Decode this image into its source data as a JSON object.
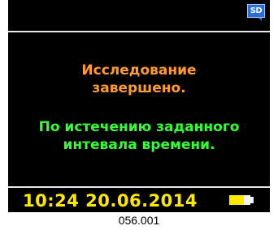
{
  "status": {
    "sd_label": "SD"
  },
  "message": {
    "line1": "Исследование",
    "line2": "завершено.",
    "line3": "По истечению заданного",
    "line4": "интевала времени."
  },
  "footer": {
    "time": "10:24",
    "date": "20.06.2014",
    "battery_level": 0.7
  },
  "caption": "056.001",
  "colors": {
    "screen_background": "#000000",
    "message_orange": "#ff9a2e",
    "message_green": "#33ff33",
    "datetime_yellow": "#ffe800",
    "sd_icon_blue": "#2a6fd8"
  }
}
